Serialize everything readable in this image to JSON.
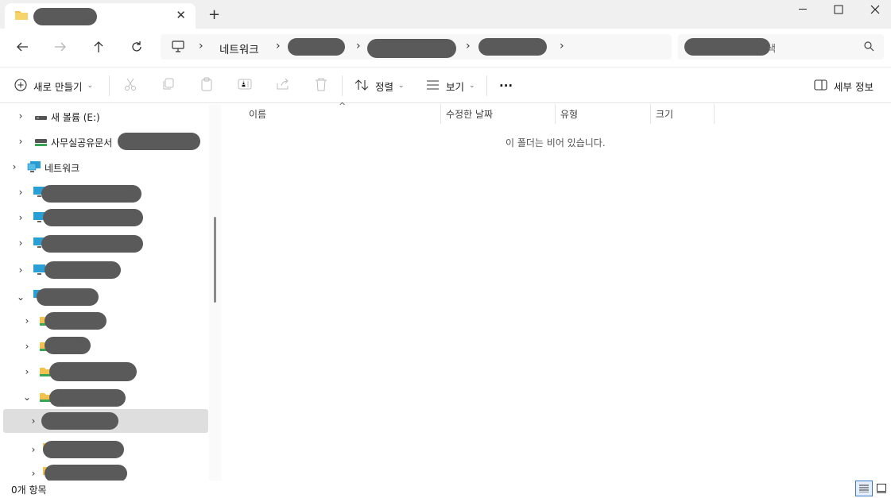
{
  "titlebar": {
    "new_tab": "+",
    "close_tab": "✕",
    "minimize": "—",
    "maximize": "☐",
    "close": "✕"
  },
  "address": {
    "breadcrumb_network": "네트워크",
    "search_placeholder_tail": "색"
  },
  "toolbar": {
    "new_label": "새로 만들기",
    "sort_label": "정렬",
    "view_label": "보기",
    "more_label": "···",
    "details_label": "세부 정보"
  },
  "nav": {
    "drive_e": "새 볼륨 (E:)",
    "shared_drive": "사무실공유문서",
    "network": "네트워크"
  },
  "content": {
    "columns": [
      "이름",
      "수정한 날짜",
      "유형",
      "크기"
    ],
    "empty_message": "이 폴더는 비어 있습니다."
  },
  "status": {
    "item_count": "0개 항목"
  },
  "colors": {
    "selected": "#dedede",
    "monitor_blue": "#2a9fd6",
    "folder_yellow": "#f2c14e"
  }
}
